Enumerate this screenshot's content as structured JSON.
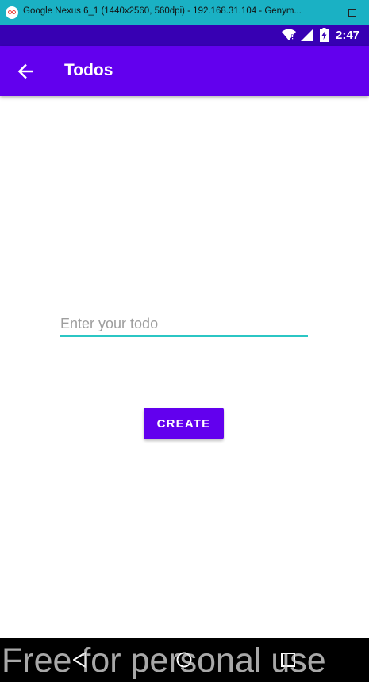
{
  "window": {
    "title": "Google Nexus 6_1 (1440x2560, 560dpi) - 192.168.31.104 - Genym...",
    "icon": "genymotion-icon",
    "controls": [
      "minimize-icon",
      "maximize-icon"
    ]
  },
  "status_bar": {
    "icons": [
      "wifi-icon",
      "signal-icon",
      "battery-charging-icon"
    ],
    "time": "2:47"
  },
  "app_bar": {
    "back_icon": "arrow-back-icon",
    "title": "Todos"
  },
  "form": {
    "todo_input": {
      "value": "",
      "placeholder": "Enter your todo"
    },
    "create_label": "CREATE"
  },
  "nav_bar": {
    "icons": [
      "nav-back-icon",
      "nav-home-icon",
      "nav-recents-icon"
    ]
  },
  "watermark": "Free for personal use",
  "colors": {
    "window_bar": "#1ab1c4",
    "status_bar": "#3700b3",
    "primary": "#6200ee",
    "input_underline": "#2bc6c4",
    "nav_bar": "#000000"
  }
}
